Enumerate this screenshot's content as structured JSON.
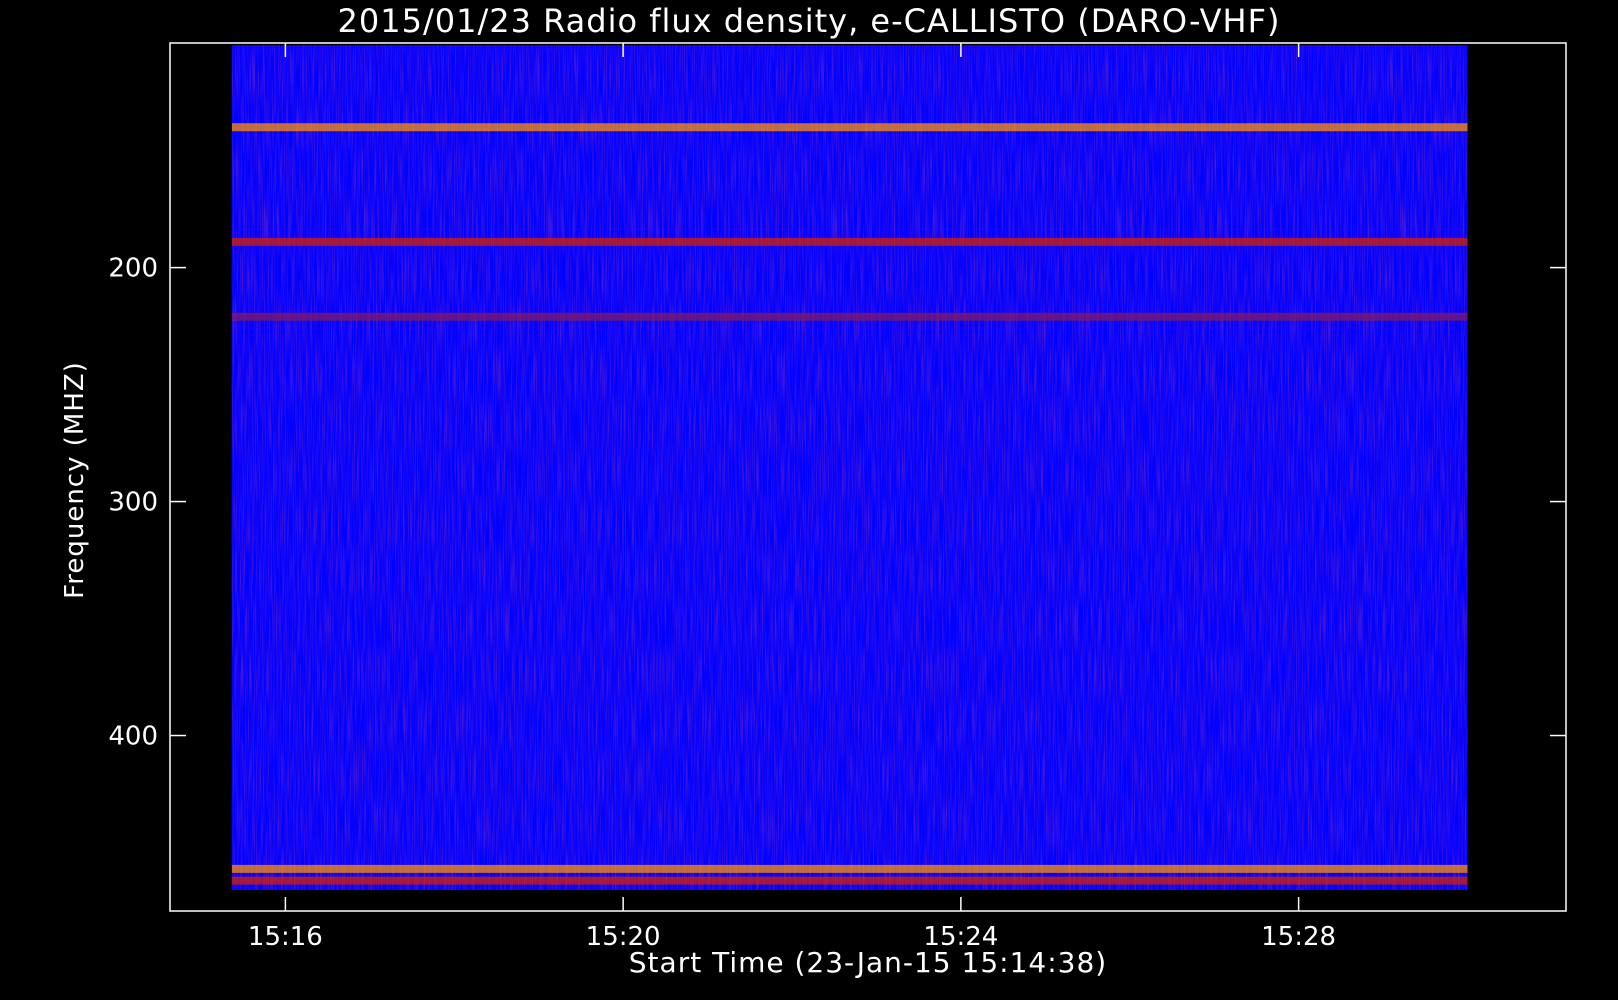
{
  "chart_data": {
    "type": "heatmap",
    "title": "2015/01/23  Radio flux density, e-CALLISTO (DARO-VHF)",
    "xlabel": "Start Time (23-Jan-15 15:14:38)",
    "ylabel": "Frequency (MHZ)",
    "x_ticks": [
      "15:16",
      "15:20",
      "15:24",
      "15:28"
    ],
    "y_ticks": [
      200,
      300,
      400
    ],
    "x_range": [
      "15:14:38",
      "15:31:10"
    ],
    "y_range_mhz": [
      475,
      104
    ],
    "data_x_range": [
      "15:15:22",
      "15:30:00"
    ],
    "data_y_range_mhz": [
      466,
      105
    ],
    "colormap": [
      "#000000",
      "#0000ff",
      "#7f1a66",
      "#d42000",
      "#ff9000",
      "#ffff60"
    ],
    "features": [
      {
        "kind": "band",
        "freq_mhz": 140,
        "level": "high",
        "note": "intermittent bursts"
      },
      {
        "kind": "band",
        "freq_mhz": 189,
        "level": "medium"
      },
      {
        "kind": "band",
        "freq_mhz": 221,
        "level": "low"
      },
      {
        "kind": "band",
        "freq_mhz": 457,
        "level": "high",
        "note": "spiky vertical bursts"
      },
      {
        "kind": "band",
        "freq_mhz": 462,
        "level": "medium"
      }
    ],
    "grid": false,
    "legend": "none"
  }
}
